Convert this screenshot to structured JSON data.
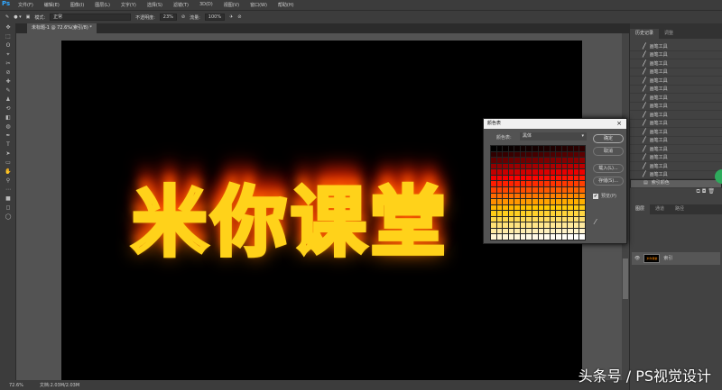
{
  "app": {
    "logo": "Ps"
  },
  "menu": [
    "文件(F)",
    "编辑(E)",
    "图像(I)",
    "图层(L)",
    "文字(Y)",
    "选择(S)",
    "滤镜(T)",
    "3D(D)",
    "视图(V)",
    "窗口(W)",
    "帮助(H)"
  ],
  "options": {
    "mode_label": "模式:",
    "mode_value": "正常",
    "opacity_label": "不透明度:",
    "opacity_value": "23%",
    "flow_label": "流量:",
    "flow_value": "100%"
  },
  "document": {
    "tab": "未标题-1 @ 72.6%(索引/8) *",
    "text": "米你课堂"
  },
  "status": {
    "zoom": "72.6%",
    "doc": "文档:2.03M/2.03M"
  },
  "history": {
    "tabs": [
      "历史记录",
      "调整"
    ],
    "items": [
      "画笔工具",
      "画笔工具",
      "画笔工具",
      "画笔工具",
      "画笔工具",
      "画笔工具",
      "画笔工具",
      "画笔工具",
      "画笔工具",
      "画笔工具",
      "画笔工具",
      "画笔工具",
      "画笔工具",
      "画笔工具",
      "画笔工具",
      "画笔工具"
    ],
    "selected": "索引颜色"
  },
  "layers": {
    "tabs": [
      "图层",
      "通道",
      "路径"
    ],
    "layer_name": "索引"
  },
  "dialog": {
    "title": "颜色表",
    "table_label": "颜色表:",
    "table_value": "黑体",
    "ok": "确定",
    "cancel": "取消",
    "load": "载入(L)...",
    "save": "存储(S)...",
    "preview": "预览(P)",
    "preview_checked": true
  },
  "watermark": "头条号 / PS视觉设计"
}
